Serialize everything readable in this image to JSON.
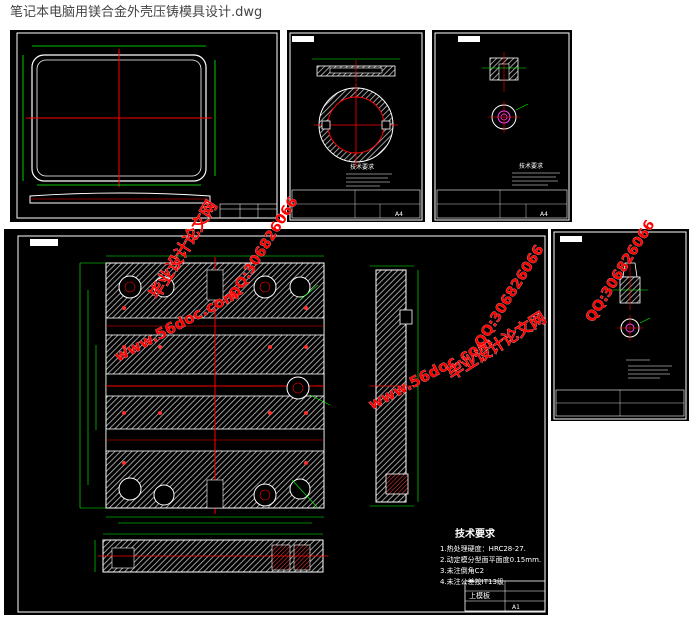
{
  "window": {
    "title": "笔记本电脑用镁合金外壳压铸模具设计.dwg"
  },
  "watermarks": {
    "text_cn": "毕业设计论文网",
    "url": "www.56doc.com",
    "qq": "QQ:306826066"
  },
  "sheets": {
    "sheet2": {
      "notes_title": "技术要求",
      "size": "A4"
    },
    "sheet3": {
      "notes_title": "技术要求",
      "size": "A4"
    },
    "main": {
      "notes_title": "技术要求",
      "notes": [
        "1.热处理硬度：HRC28-27.",
        "2.动定模分型面平面度0.15mm.",
        "3.未注倒角C2",
        "4.未注公差按IT13级"
      ],
      "titleblock_name": "上模板",
      "size": "A1"
    }
  },
  "colors": {
    "drawing_bg": "#000000",
    "frame": "#ffffff",
    "dimension": "#00ff00",
    "centerline": "#ff0000",
    "watermark": "#ff0000",
    "hatch": "#c0c0c0"
  }
}
